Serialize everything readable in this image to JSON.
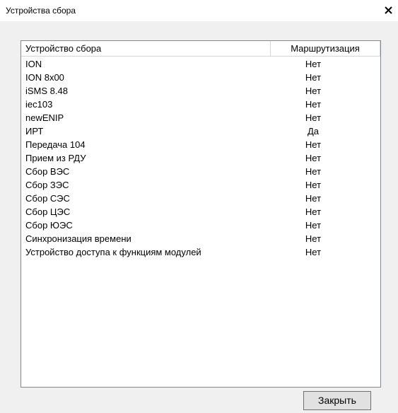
{
  "window": {
    "title": "Устройства сбора"
  },
  "list": {
    "columns": {
      "name": "Устройство сбора",
      "routing": "Маршрутизация"
    },
    "rows": [
      {
        "name": "ION",
        "routing": "Нет"
      },
      {
        "name": "ION 8x00",
        "routing": "Нет"
      },
      {
        "name": "iSMS 8.48",
        "routing": "Нет"
      },
      {
        "name": "iec103",
        "routing": "Нет"
      },
      {
        "name": "newENIP",
        "routing": "Нет"
      },
      {
        "name": "ИРТ",
        "routing": "Да"
      },
      {
        "name": "Передача 104",
        "routing": "Нет"
      },
      {
        "name": "Прием из РДУ",
        "routing": "Нет"
      },
      {
        "name": "Сбор ВЭС",
        "routing": "Нет"
      },
      {
        "name": "Сбор ЗЭС",
        "routing": "Нет"
      },
      {
        "name": "Сбор СЭС",
        "routing": "Нет"
      },
      {
        "name": "Сбор ЦЭС",
        "routing": "Нет"
      },
      {
        "name": "Сбор ЮЭС",
        "routing": "Нет"
      },
      {
        "name": "Синхронизация времени",
        "routing": "Нет"
      },
      {
        "name": "Устройство доступа к функциям модулей",
        "routing": "Нет"
      }
    ]
  },
  "footer": {
    "close_label": "Закрыть"
  },
  "icons": {
    "close": "close-icon"
  }
}
